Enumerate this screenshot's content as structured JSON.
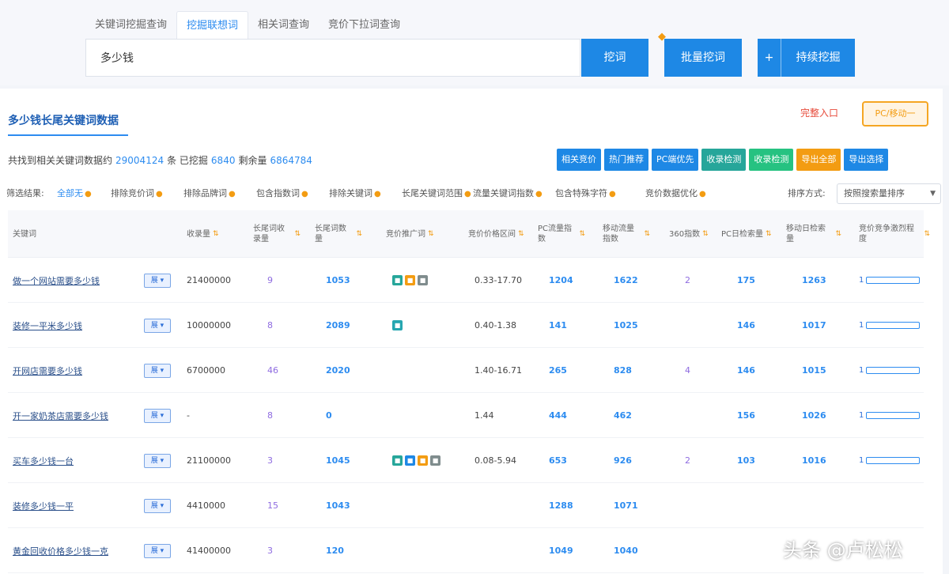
{
  "search": {
    "tabs": [
      "关键词挖掘查询",
      "挖掘联想词",
      "相关词查询",
      "竞价下拉词查询"
    ],
    "active_tab": 1,
    "input_value": "多少钱",
    "search_button": "挖词",
    "batch_button": "批量挖词",
    "mining_plus": "+",
    "mining_button": "持续挖掘"
  },
  "result": {
    "title": "多少钱长尾关键词数据",
    "red_link": "完整入口",
    "orange_button": "PC/移动一",
    "summary_prefix": "共找到相关关键词数据约",
    "summary_total": "29004124",
    "summary_mid1": "条 已挖掘",
    "summary_mined": "6840",
    "summary_mid2": "剩余量",
    "summary_remaining": "6864784"
  },
  "actions": [
    {
      "label": "相关竞价",
      "color": "#1e88e5"
    },
    {
      "label": "热门推荐",
      "color": "#1e88e5"
    },
    {
      "label": "PC端优先",
      "color": "#1e88e5"
    },
    {
      "label": "收录检测",
      "color": "#26a69a"
    },
    {
      "label": "收录检测",
      "color": "#26c281"
    },
    {
      "label": "导出全部",
      "color": "#f39c12"
    },
    {
      "label": "导出选择",
      "color": "#1e88e5"
    }
  ],
  "filters": {
    "items": [
      {
        "label": "筛选结果:",
        "tip": ""
      },
      {
        "label": "全部无",
        "tip": "●",
        "blue": true
      },
      {
        "label": "排除竞价词",
        "tip": "●"
      },
      {
        "label": "排除品牌词",
        "tip": "●"
      },
      {
        "label": "包含指数词",
        "tip": "●"
      },
      {
        "label": "排除关键词",
        "tip": "●"
      },
      {
        "label": "长尾关键词范围",
        "tip": "●"
      },
      {
        "label": "流量关键词指数",
        "tip": "●"
      },
      {
        "label": "包含特殊字符",
        "tip": "●"
      },
      {
        "label": "竞价数据优化",
        "tip": "●"
      }
    ],
    "sort_label": "排序方式:",
    "sort_value": "按照搜索量排序"
  },
  "table": {
    "headers": [
      "关键词",
      "收录量",
      "长尾词收录量",
      "长尾词数量",
      "竞价推广词",
      "竞价价格区间",
      "PC流量指数",
      "移动流量指数",
      "360指数",
      "PC日检索量",
      "移动日检索量",
      "竞价竞争激烈程度"
    ],
    "rows": [
      {
        "keyword": "做一个网站需要多少钱",
        "tag": "展",
        "included": "21400000",
        "long_count": "9",
        "long_num": "1053",
        "icons": [
          "#26a69a",
          "#f39c12",
          "#7f8c8d"
        ],
        "price": "0.33-17.70",
        "pc_index": "1204",
        "mobile_index": "1622",
        "index360": "2",
        "pc_daily": "175",
        "mobile_daily": "1263",
        "bar_num": "1"
      },
      {
        "keyword": "装修一平米多少钱",
        "tag": "展",
        "included": "10000000",
        "long_count": "8",
        "long_num": "2089",
        "icons": [
          "#26a6b0"
        ],
        "price": "0.40-1.38",
        "pc_index": "141",
        "mobile_index": "1025",
        "index360": "",
        "pc_daily": "146",
        "mobile_daily": "1017",
        "bar_num": "1"
      },
      {
        "keyword": "开网店需要多少钱",
        "tag": "展",
        "included": "6700000",
        "long_count": "46",
        "long_num": "2020",
        "icons": [],
        "price": "1.40-16.71",
        "pc_index": "265",
        "mobile_index": "828",
        "index360": "4",
        "pc_daily": "146",
        "mobile_daily": "1015",
        "bar_num": "1"
      },
      {
        "keyword": "开一家奶茶店需要多少钱",
        "tag": "展",
        "included": "-",
        "long_count": "8",
        "long_num": "0",
        "icons": [],
        "price": "1.44",
        "pc_index": "444",
        "mobile_index": "462",
        "index360": "",
        "pc_daily": "156",
        "mobile_daily": "1026",
        "bar_num": "1"
      },
      {
        "keyword": "买车多少钱一台",
        "tag": "展",
        "included": "21100000",
        "long_count": "3",
        "long_num": "1045",
        "icons": [
          "#26a69a",
          "#1e88e5",
          "#f39c12",
          "#7f8c8d"
        ],
        "price": "0.08-5.94",
        "pc_index": "653",
        "mobile_index": "926",
        "index360": "2",
        "pc_daily": "103",
        "mobile_daily": "1016",
        "bar_num": "1"
      },
      {
        "keyword": "装修多少钱一平",
        "tag": "展",
        "included": "4410000",
        "long_count": "15",
        "long_num": "1043",
        "icons": [],
        "price": "",
        "pc_index": "1288",
        "mobile_index": "1071",
        "index360": "",
        "pc_daily": "",
        "mobile_daily": "",
        "bar_num": ""
      },
      {
        "keyword": "黄金回收价格多少钱一克",
        "tag": "展",
        "included": "41400000",
        "long_count": "3",
        "long_num": "120",
        "icons": [],
        "price": "",
        "pc_index": "1049",
        "mobile_index": "1040",
        "index360": "",
        "pc_daily": "",
        "mobile_daily": "",
        "bar_num": ""
      }
    ]
  },
  "watermark": "头条 @卢松松"
}
